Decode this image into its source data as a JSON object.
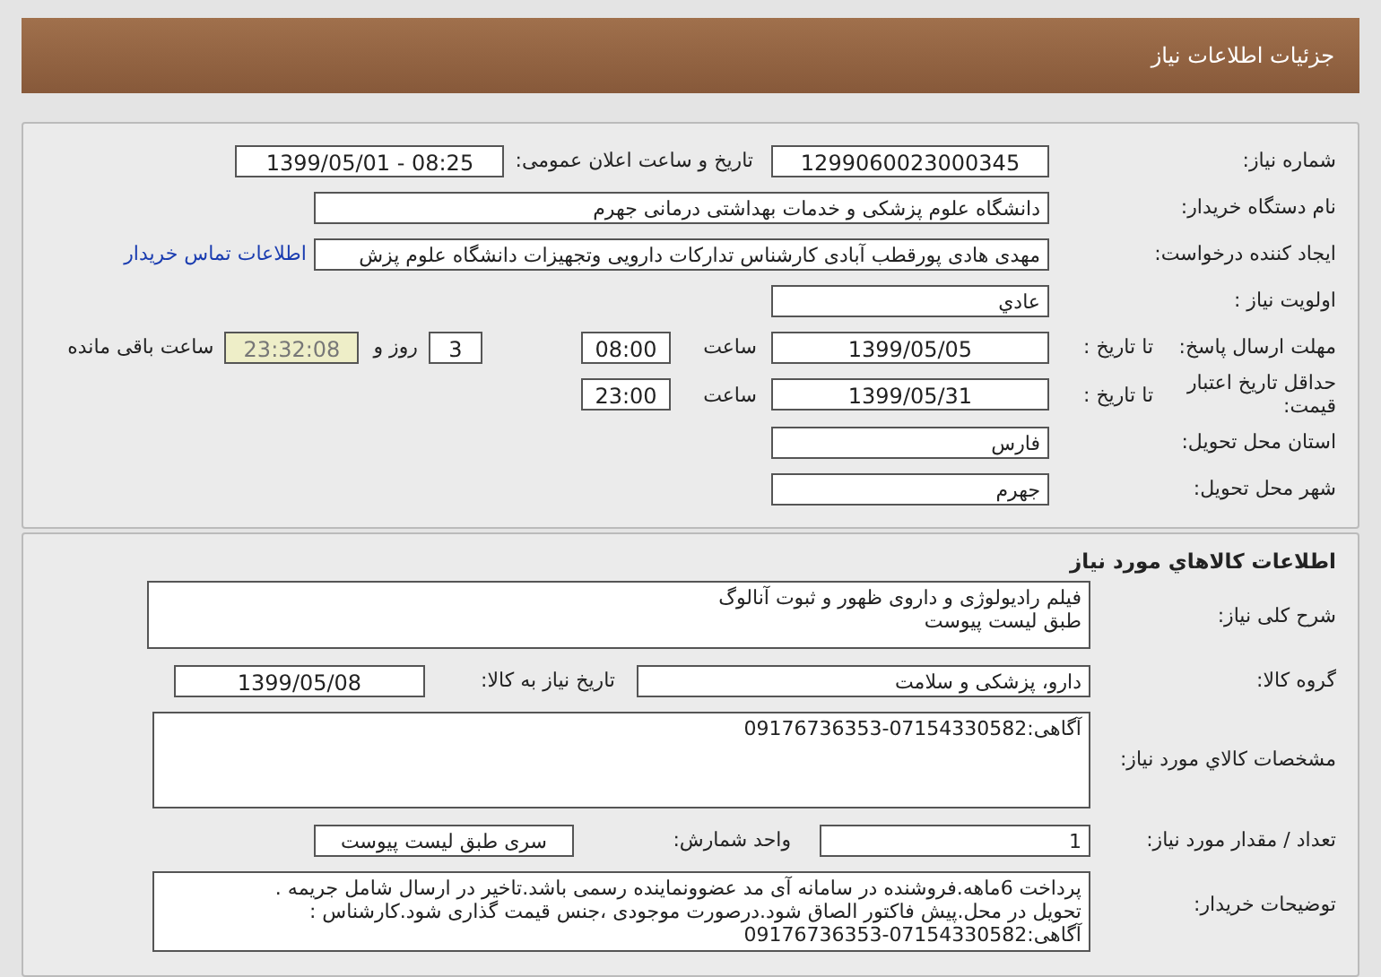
{
  "header": {
    "title": "جزئیات اطلاعات نیاز"
  },
  "general": {
    "need_number": {
      "label": "شماره نیاز:",
      "value": "1299060023000345"
    },
    "announce": {
      "label": "تاریخ و ساعت اعلان عمومی:",
      "value": "1399/05/01 - 08:25"
    },
    "buyer": {
      "label": "نام دستگاه خریدار:",
      "value": "دانشگاه علوم پزشکی و خدمات بهداشتی درمانی جهرم"
    },
    "creator": {
      "label": "ایجاد کننده درخواست:",
      "value": "مهدی هادی پورقطب آبادی کارشناس تدارکات دارویی وتجهیزات دانشگاه علوم پزش",
      "link": "اطلاعات تماس خریدار"
    },
    "priority": {
      "label": "اولویت نیاز :",
      "value": "عادي"
    },
    "response_deadline": {
      "label": "مهلت ارسال پاسخ:",
      "to_date_label": "تا تاریخ :",
      "date": "1399/05/05",
      "time_label": "ساعت",
      "time": "08:00",
      "days": "3",
      "days_label": "روز و",
      "remaining": "23:32:08",
      "remaining_label": "ساعت باقی مانده"
    },
    "price_validity": {
      "label": "حداقل تاریخ اعتبار قیمت:",
      "to_date_label": "تا تاریخ :",
      "date": "1399/05/31",
      "time_label": "ساعت",
      "time": "23:00"
    },
    "province": {
      "label": "استان محل تحویل:",
      "value": "فارس"
    },
    "city": {
      "label": "شهر محل تحویل:",
      "value": "جهرم"
    }
  },
  "goods": {
    "title": "اطلاعات کالاهاي مورد نياز",
    "description": {
      "label": "شرح کلی نیاز:",
      "lines": [
        "فیلم رادیولوژی و داروی ظهور و ثبوت آنالوگ",
        "طبق لیست پیوست"
      ]
    },
    "group": {
      "label": "گروه کالا:",
      "value": "دارو، پزشکی و سلامت",
      "need_date_label": "تاریخ نیاز به کالا:",
      "need_date": "1399/05/08"
    },
    "specs": {
      "label": "مشخصات کالاي مورد نياز:",
      "value": "آگاهی:07154330582-09176736353"
    },
    "quantity": {
      "label": "تعداد / مقدار مورد نیاز:",
      "value": "1",
      "unit_label": "واحد شمارش:",
      "unit": "سری طبق لیست پیوست"
    },
    "notes": {
      "label": "توضیحات خریدار:",
      "lines": [
        "پرداخت 6ماهه.فروشنده در سامانه آی مد عضوونماینده رسمی باشد.تاخیر در ارسال شامل جریمه .",
        "تحویل در محل.پیش فاکتور الصاق شود.درصورت موجودی ،جنس قیمت گذاری شود.کارشناس :",
        "آگاهی:07154330582-09176736353"
      ]
    }
  }
}
